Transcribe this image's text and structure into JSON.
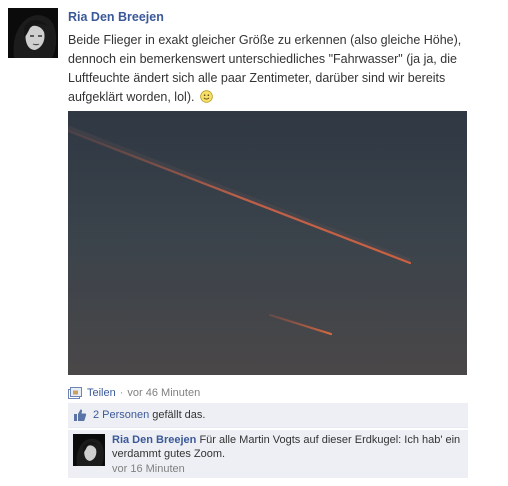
{
  "post": {
    "author": "Ria Den Breejen",
    "text": "Beide Flieger in exakt gleicher Größe zu erkennen (also gleiche Höhe), dennoch ein bemerkenswert unterschiedliches \"Fahrwasser\" (ja ja, die Luftfeuchte ändert sich alle paar Zentimeter, darüber sind wir bereits aufgeklärt worden, lol).",
    "smiley_icon": "smiley-icon"
  },
  "meta": {
    "share_icon": "share-icon",
    "share_label": "Teilen",
    "separator": "·",
    "time": "vor 46 Minuten"
  },
  "likes": {
    "icon": "thumbs-up-icon",
    "count_label": "2 Personen",
    "suffix": "gefällt das."
  },
  "comment": {
    "author": "Ria Den Breejen",
    "text": "Für alle Martin Vogts auf dieser Erdkugel: Ich hab' ein verdammt gutes Zoom.",
    "time": "vor 16 Minuten"
  },
  "colors": {
    "link": "#3b5998",
    "feedback_bg": "#edeff4",
    "muted": "#808080"
  }
}
